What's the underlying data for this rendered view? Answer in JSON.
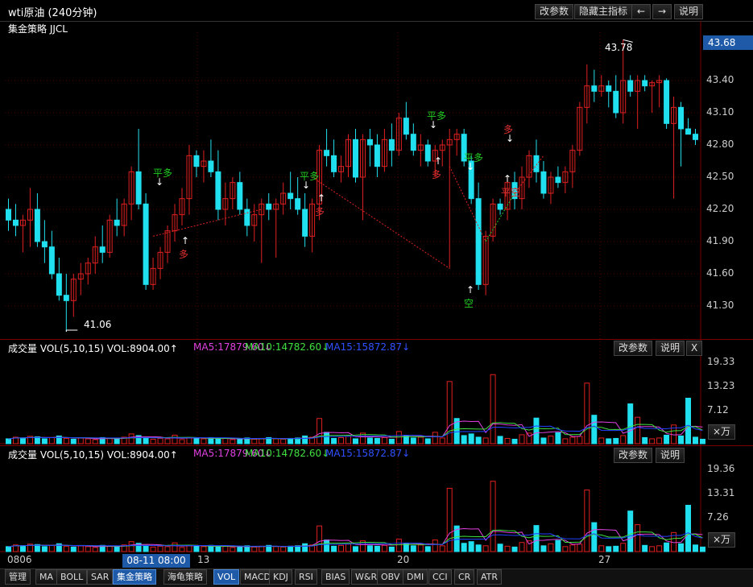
{
  "window": {
    "title": "wti原油 (240分钟)",
    "buttons": {
      "params": "改参数",
      "hide": "隐藏主指标",
      "left": "←",
      "right": "→",
      "help": "说明"
    }
  },
  "strategy_label": "集金策略 JJCL",
  "price_axis": {
    "current": "43.68",
    "ticks": [
      "43.40",
      "43.10",
      "42.80",
      "42.50",
      "42.20",
      "41.90",
      "41.60",
      "41.30"
    ]
  },
  "extremes": {
    "high": "43.78",
    "low": "41.06"
  },
  "signals": [
    {
      "text": "平多",
      "color": "#22cc22"
    },
    {
      "text": "多",
      "color": "#e03030"
    },
    {
      "text": "平多",
      "color": "#22cc22"
    },
    {
      "text": "多",
      "color": "#e03030"
    },
    {
      "text": "平多",
      "color": "#22cc22"
    },
    {
      "text": "多",
      "color": "#e03030"
    },
    {
      "text": "空",
      "color": "#22cc22"
    },
    {
      "text": "平多",
      "color": "#22cc22"
    },
    {
      "text": "多",
      "color": "#e03030"
    },
    {
      "text": "平空",
      "color": "#e03030"
    }
  ],
  "volume_panels": [
    {
      "indicator": "成交量 VOL(5,10,15) VOL:8904.00↑",
      "ma5": "MA5:17879.60↓",
      "ma10": "MA10:14782.60↓",
      "ma15": "MA15:15872.87↓",
      "params_btn": "改参数",
      "help_btn": "说明",
      "close_btn": "X",
      "ticks": [
        "19.33",
        "13.23",
        "7.12"
      ],
      "unit": "×万"
    },
    {
      "indicator": "成交量 VOL(5,10,15) VOL:8904.00↑",
      "ma5": "MA5:17879.60↓",
      "ma10": "MA10:14782.60↓",
      "ma15": "MA15:15872.87↓",
      "params_btn": "改参数",
      "help_btn": "说明",
      "ticks": [
        "19.36",
        "13.31",
        "7.26"
      ],
      "unit": "×万"
    }
  ],
  "x_axis": {
    "labels": [
      "0806",
      "13",
      "20",
      "27"
    ],
    "cursor_date": "08-11 08:00"
  },
  "bottom_tabs": [
    "管理",
    "MA",
    "BOLL",
    "SAR",
    "集金策略",
    "海龟策略",
    "VOL",
    "MACD",
    "KDJ",
    "RSI",
    "BIAS",
    "W&R",
    "OBV",
    "DMI",
    "CCI",
    "CR",
    "ATR"
  ],
  "colors": {
    "up": "#e02020",
    "down": "#20e0f0",
    "ma5": "#e040e0",
    "ma10": "#40e040",
    "ma15": "#2040ff",
    "accent": "#1e5aa8"
  },
  "chart_data": {
    "type": "candlestick",
    "ylim": [
      41.0,
      43.85
    ],
    "candles": [
      [
        42.2,
        42.3,
        42.0,
        42.1
      ],
      [
        42.1,
        42.25,
        41.95,
        42.05
      ],
      [
        42.05,
        42.15,
        41.8,
        42.1
      ],
      [
        42.1,
        42.4,
        41.85,
        42.2
      ],
      [
        42.2,
        42.35,
        41.85,
        41.9
      ],
      [
        41.9,
        42.1,
        41.7,
        41.85
      ],
      [
        41.85,
        42.0,
        41.55,
        41.6
      ],
      [
        41.6,
        41.75,
        41.35,
        41.4
      ],
      [
        41.4,
        41.6,
        41.06,
        41.35
      ],
      [
        41.35,
        41.6,
        41.2,
        41.55
      ],
      [
        41.55,
        41.7,
        41.4,
        41.6
      ],
      [
        41.6,
        41.75,
        41.5,
        41.7
      ],
      [
        41.7,
        41.95,
        41.6,
        41.85
      ],
      [
        41.85,
        42.05,
        41.7,
        41.8
      ],
      [
        41.8,
        42.15,
        41.75,
        42.1
      ],
      [
        42.1,
        42.3,
        41.95,
        42.05
      ],
      [
        42.05,
        42.3,
        41.95,
        42.25
      ],
      [
        42.25,
        42.6,
        42.1,
        42.55
      ],
      [
        42.55,
        42.95,
        42.2,
        42.25
      ],
      [
        42.25,
        42.35,
        41.45,
        41.5
      ],
      [
        41.5,
        41.75,
        41.45,
        41.65
      ],
      [
        41.65,
        41.85,
        41.55,
        41.8
      ],
      [
        41.8,
        42.05,
        41.7,
        42.0
      ],
      [
        42.0,
        42.25,
        41.9,
        42.15
      ],
      [
        42.15,
        42.4,
        42.05,
        42.3
      ],
      [
        42.3,
        42.8,
        42.15,
        42.7
      ],
      [
        42.7,
        42.75,
        42.5,
        42.6
      ],
      [
        42.6,
        42.75,
        42.45,
        42.65
      ],
      [
        42.65,
        42.85,
        42.5,
        42.55
      ],
      [
        42.55,
        42.75,
        42.1,
        42.2
      ],
      [
        42.2,
        42.45,
        42.05,
        42.3
      ],
      [
        42.3,
        42.5,
        42.2,
        42.45
      ],
      [
        42.45,
        42.55,
        42.15,
        42.2
      ],
      [
        42.2,
        42.3,
        41.95,
        42.05
      ],
      [
        42.05,
        42.25,
        41.9,
        42.15
      ],
      [
        42.15,
        42.3,
        41.7,
        42.25
      ],
      [
        42.25,
        42.35,
        42.1,
        42.2
      ],
      [
        42.2,
        42.3,
        41.75,
        42.25
      ],
      [
        42.25,
        42.45,
        42.15,
        42.35
      ],
      [
        42.35,
        42.55,
        42.2,
        42.3
      ],
      [
        42.3,
        42.5,
        42.15,
        42.2
      ],
      [
        42.2,
        42.35,
        41.85,
        41.95
      ],
      [
        41.95,
        42.3,
        41.8,
        42.25
      ],
      [
        42.25,
        42.8,
        42.1,
        42.75
      ],
      [
        42.75,
        42.95,
        42.6,
        42.7
      ],
      [
        42.7,
        42.85,
        42.5,
        42.55
      ],
      [
        42.55,
        42.7,
        42.45,
        42.6
      ],
      [
        42.6,
        42.9,
        42.5,
        42.85
      ],
      [
        42.85,
        42.95,
        42.45,
        42.5
      ],
      [
        42.5,
        42.9,
        42.1,
        42.85
      ],
      [
        42.85,
        42.95,
        42.6,
        42.8
      ],
      [
        42.8,
        42.9,
        42.5,
        42.6
      ],
      [
        42.6,
        42.95,
        42.55,
        42.85
      ],
      [
        42.85,
        43.0,
        42.6,
        42.75
      ],
      [
        42.75,
        43.1,
        42.7,
        43.05
      ],
      [
        43.05,
        43.2,
        42.85,
        42.9
      ],
      [
        42.9,
        43.0,
        42.7,
        42.75
      ],
      [
        42.75,
        42.9,
        42.6,
        42.8
      ],
      [
        42.8,
        42.85,
        42.6,
        42.65
      ],
      [
        42.65,
        42.8,
        42.5,
        42.75
      ],
      [
        42.75,
        42.85,
        42.6,
        42.8
      ],
      [
        42.8,
        42.95,
        41.65,
        42.85
      ],
      [
        42.85,
        42.95,
        42.7,
        42.9
      ],
      [
        42.9,
        42.95,
        42.6,
        42.65
      ],
      [
        42.65,
        42.7,
        42.25,
        42.3
      ],
      [
        42.3,
        42.45,
        41.45,
        41.5
      ],
      [
        41.5,
        42.0,
        41.4,
        41.95
      ],
      [
        41.95,
        42.3,
        41.9,
        42.25
      ],
      [
        42.25,
        42.3,
        42.15,
        42.2
      ],
      [
        42.2,
        42.5,
        42.1,
        42.45
      ],
      [
        42.45,
        42.55,
        42.2,
        42.3
      ],
      [
        42.3,
        42.6,
        42.2,
        42.5
      ],
      [
        42.5,
        42.75,
        42.4,
        42.7
      ],
      [
        42.7,
        42.85,
        42.45,
        42.55
      ],
      [
        42.55,
        42.65,
        42.3,
        42.35
      ],
      [
        42.35,
        42.55,
        42.25,
        42.5
      ],
      [
        42.5,
        42.6,
        42.4,
        42.45
      ],
      [
        42.45,
        42.6,
        42.35,
        42.55
      ],
      [
        42.55,
        42.8,
        42.4,
        42.75
      ],
      [
        42.75,
        43.2,
        42.7,
        43.15
      ],
      [
        43.15,
        43.55,
        43.0,
        43.35
      ],
      [
        43.35,
        43.5,
        43.2,
        43.3
      ],
      [
        43.3,
        43.45,
        43.25,
        43.35
      ],
      [
        43.35,
        43.4,
        43.15,
        43.3
      ],
      [
        43.3,
        43.45,
        43.05,
        43.1
      ],
      [
        43.1,
        43.78,
        43.0,
        43.4
      ],
      [
        43.4,
        43.45,
        43.25,
        43.3
      ],
      [
        43.3,
        43.45,
        42.95,
        43.4
      ],
      [
        43.4,
        43.45,
        43.3,
        43.35
      ],
      [
        43.35,
        43.4,
        43.1,
        43.38
      ],
      [
        43.38,
        43.45,
        43.15,
        43.4
      ],
      [
        43.4,
        43.42,
        42.95,
        43.0
      ],
      [
        43.0,
        43.25,
        42.3,
        43.15
      ],
      [
        43.15,
        43.2,
        42.6,
        42.95
      ],
      [
        42.95,
        43.05,
        42.9,
        42.9
      ],
      [
        42.9,
        42.95,
        42.8,
        42.85
      ]
    ],
    "vol1_max": 22.0,
    "vol2_max": 22.0,
    "volumes": [
      1.2,
      1.6,
      1.4,
      1.8,
      1.7,
      1.2,
      1.5,
      1.9,
      1.3,
      1.1,
      1.4,
      1.2,
      1.0,
      1.5,
      1.3,
      1.2,
      1.6,
      2.4,
      2.0,
      1.4,
      1.1,
      1.3,
      1.2,
      2.1,
      1.0,
      1.4,
      1.3,
      1.2,
      1.5,
      1.1,
      1.3,
      1.0,
      1.2,
      1.4,
      1.1,
      1.3,
      1.5,
      1.2,
      1.1,
      1.3,
      1.4,
      1.9,
      1.6,
      6.2,
      2.8,
      1.3,
      1.5,
      1.8,
      1.2,
      2.6,
      1.4,
      1.3,
      1.5,
      1.1,
      3.0,
      2.0,
      1.4,
      1.6,
      1.2,
      2.8,
      1.4,
      15.3,
      6.2,
      2.0,
      2.4,
      1.6,
      1.4,
      17.0,
      1.8,
      1.3,
      1.1,
      2.2,
      2.6,
      6.3,
      1.4,
      1.9,
      2.7,
      1.2,
      1.6,
      1.8,
      14.9,
      7.0,
      1.4,
      1.2,
      1.3,
      2.0,
      9.8,
      6.5,
      1.5,
      1.2,
      1.4,
      2.1,
      4.6,
      1.9,
      11.2,
      1.6,
      1.1
    ],
    "volume_dirs": [
      "d",
      "u",
      "d",
      "u",
      "d",
      "d",
      "u",
      "d",
      "u",
      "d",
      "u",
      "u",
      "u",
      "d",
      "u",
      "d",
      "u",
      "u",
      "d",
      "d",
      "u",
      "u",
      "u",
      "u",
      "u",
      "u",
      "d",
      "u",
      "d",
      "d",
      "u",
      "u",
      "d",
      "d",
      "u",
      "u",
      "d",
      "u",
      "u",
      "d",
      "d",
      "d",
      "u",
      "u",
      "d",
      "d",
      "u",
      "u",
      "d",
      "u",
      "d",
      "d",
      "u",
      "d",
      "u",
      "d",
      "d",
      "u",
      "d",
      "u",
      "u",
      "u",
      "d",
      "d",
      "d",
      "d",
      "u",
      "u",
      "d",
      "u",
      "d",
      "u",
      "u",
      "d",
      "d",
      "u",
      "d",
      "u",
      "u",
      "u",
      "u",
      "d",
      "u",
      "d",
      "d",
      "u",
      "d",
      "u",
      "d",
      "u",
      "u",
      "d",
      "u",
      "d",
      "d",
      "d",
      "d"
    ]
  }
}
